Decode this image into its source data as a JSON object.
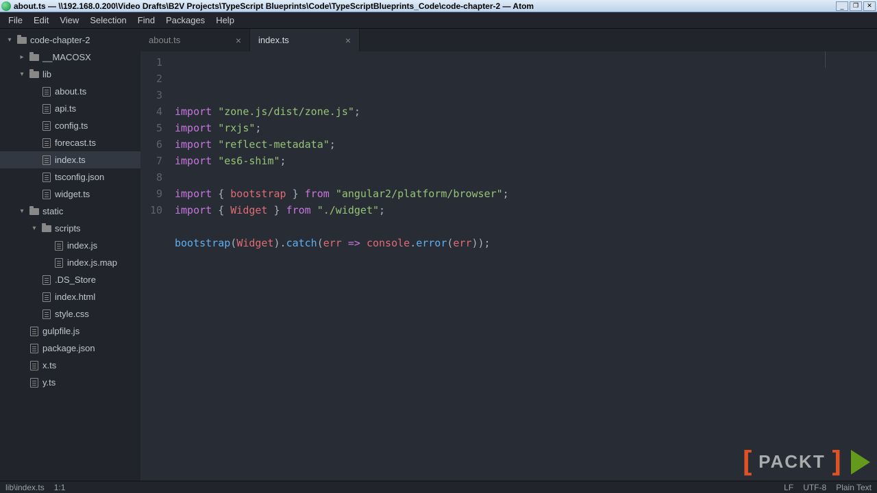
{
  "window": {
    "title": "about.ts — \\\\192.168.0.200\\Video Drafts\\B2V Projects\\TypeScript Blueprints\\Code\\TypeScriptBlueprints_Code\\code-chapter-2 — Atom"
  },
  "menu": [
    "File",
    "Edit",
    "View",
    "Selection",
    "Find",
    "Packages",
    "Help"
  ],
  "tree": [
    {
      "label": "code-chapter-2",
      "depth": 0,
      "type": "folder",
      "chev": "▾"
    },
    {
      "label": "__MACOSX",
      "depth": 1,
      "type": "folder",
      "chev": "▸"
    },
    {
      "label": "lib",
      "depth": 1,
      "type": "folder",
      "chev": "▾"
    },
    {
      "label": "about.ts",
      "depth": 2,
      "type": "file"
    },
    {
      "label": "api.ts",
      "depth": 2,
      "type": "file"
    },
    {
      "label": "config.ts",
      "depth": 2,
      "type": "file"
    },
    {
      "label": "forecast.ts",
      "depth": 2,
      "type": "file"
    },
    {
      "label": "index.ts",
      "depth": 2,
      "type": "file",
      "selected": true
    },
    {
      "label": "tsconfig.json",
      "depth": 2,
      "type": "file"
    },
    {
      "label": "widget.ts",
      "depth": 2,
      "type": "file"
    },
    {
      "label": "static",
      "depth": 1,
      "type": "folder",
      "chev": "▾"
    },
    {
      "label": "scripts",
      "depth": 2,
      "type": "folder",
      "chev": "▾"
    },
    {
      "label": "index.js",
      "depth": 3,
      "type": "file"
    },
    {
      "label": "index.js.map",
      "depth": 3,
      "type": "file"
    },
    {
      "label": ".DS_Store",
      "depth": 2,
      "type": "file"
    },
    {
      "label": "index.html",
      "depth": 2,
      "type": "file"
    },
    {
      "label": "style.css",
      "depth": 2,
      "type": "file"
    },
    {
      "label": "gulpfile.js",
      "depth": 1,
      "type": "file"
    },
    {
      "label": "package.json",
      "depth": 1,
      "type": "file"
    },
    {
      "label": "x.ts",
      "depth": 1,
      "type": "file"
    },
    {
      "label": "y.ts",
      "depth": 1,
      "type": "file"
    }
  ],
  "tabs": [
    {
      "label": "about.ts",
      "active": false
    },
    {
      "label": "index.ts",
      "active": true
    }
  ],
  "code": {
    "lines": [
      [
        [
          "k",
          "import "
        ],
        [
          "s",
          "\"zone.js/dist/zone.js\""
        ],
        [
          "p",
          ";"
        ]
      ],
      [
        [
          "k",
          "import "
        ],
        [
          "s",
          "\"rxjs\""
        ],
        [
          "p",
          ";"
        ]
      ],
      [
        [
          "k",
          "import "
        ],
        [
          "s",
          "\"reflect-metadata\""
        ],
        [
          "p",
          ";"
        ]
      ],
      [
        [
          "k",
          "import "
        ],
        [
          "s",
          "\"es6-shim\""
        ],
        [
          "p",
          ";"
        ]
      ],
      [],
      [
        [
          "k",
          "import "
        ],
        [
          "p",
          "{ "
        ],
        [
          "v",
          "bootstrap"
        ],
        [
          "p",
          " } "
        ],
        [
          "k",
          "from "
        ],
        [
          "s",
          "\"angular2/platform/browser\""
        ],
        [
          "p",
          ";"
        ]
      ],
      [
        [
          "k",
          "import "
        ],
        [
          "p",
          "{ "
        ],
        [
          "v",
          "Widget"
        ],
        [
          "p",
          " } "
        ],
        [
          "k",
          "from "
        ],
        [
          "s",
          "\"./widget\""
        ],
        [
          "p",
          ";"
        ]
      ],
      [],
      [
        [
          "fn",
          "bootstrap"
        ],
        [
          "p",
          "("
        ],
        [
          "v",
          "Widget"
        ],
        [
          "p",
          ")."
        ],
        [
          "fn",
          "catch"
        ],
        [
          "p",
          "("
        ],
        [
          "v",
          "err"
        ],
        [
          "p",
          " "
        ],
        [
          "k",
          "=>"
        ],
        [
          "p",
          " "
        ],
        [
          "v",
          "console"
        ],
        [
          "p",
          "."
        ],
        [
          "fn",
          "error"
        ],
        [
          "p",
          "("
        ],
        [
          "v",
          "err"
        ],
        [
          "p",
          "));"
        ]
      ],
      []
    ]
  },
  "status": {
    "path": "lib\\index.ts",
    "cursor": "1:1",
    "lf": "LF",
    "encoding": "UTF-8",
    "grammar": "Plain Text"
  },
  "watermark": "PACKT"
}
